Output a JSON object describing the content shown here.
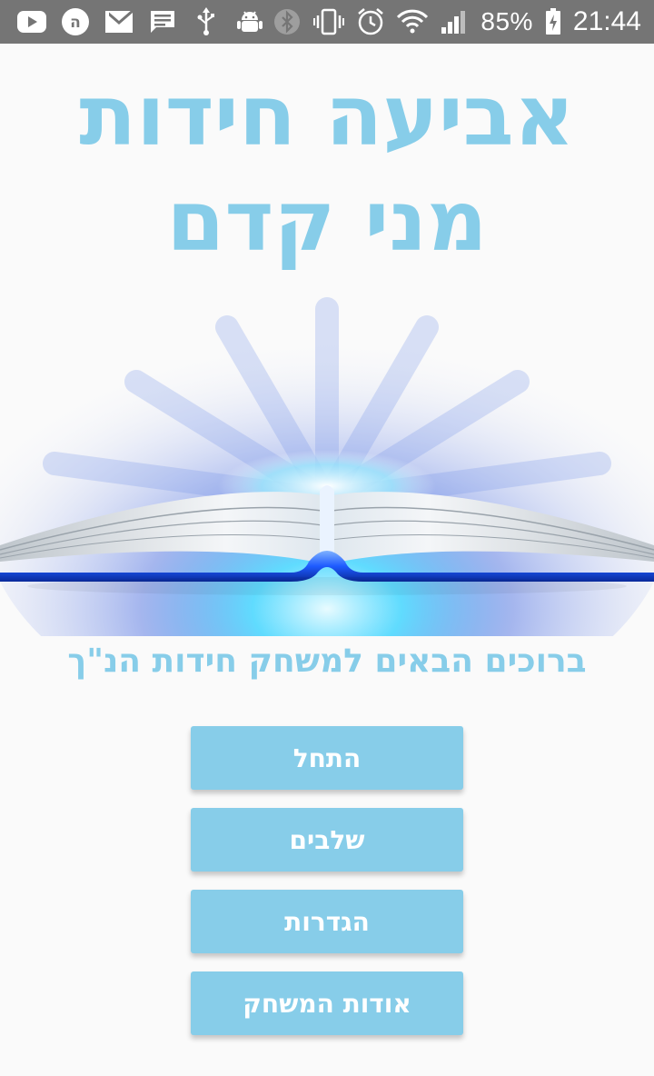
{
  "status_bar": {
    "battery": "85%",
    "time": "21:44",
    "left_icons": [
      "youtube-icon",
      "hebrew-keyboard-icon",
      "gmail-icon",
      "message-icon",
      "usb-icon",
      "android-debug-icon"
    ],
    "right_icons": [
      "bluetooth-icon",
      "vibrate-icon",
      "alarm-icon",
      "wifi-icon",
      "signal-icon",
      "battery-charging-icon"
    ]
  },
  "title": {
    "line1": "אביעה חידות",
    "line2": "מני קדם"
  },
  "welcome": "ברוכים הבאים למשחק חידות הנ\"ך",
  "menu": [
    {
      "label": "התחל"
    },
    {
      "label": "שלבים"
    },
    {
      "label": "הגדרות"
    },
    {
      "label": "אודות המשחק"
    }
  ],
  "colors": {
    "accent": "#87cde9",
    "status_bar": "#757575",
    "background": "#fafafa",
    "book_glow": "#1e5bff"
  }
}
